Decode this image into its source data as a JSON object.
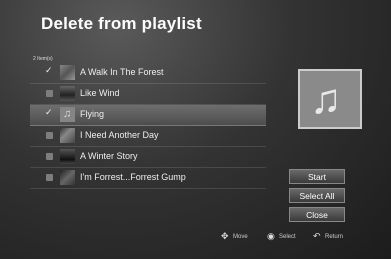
{
  "header": {
    "title": "Delete from playlist"
  },
  "list": {
    "count": "2 Item(s)",
    "items": [
      {
        "label": "A Walk In The Forest",
        "checked": true,
        "selected": false
      },
      {
        "label": "Like Wind",
        "checked": false,
        "selected": false
      },
      {
        "label": "Flying",
        "checked": true,
        "selected": true
      },
      {
        "label": "I Need Another Day",
        "checked": false,
        "selected": false
      },
      {
        "label": "A Winter Story",
        "checked": false,
        "selected": false
      },
      {
        "label": "I'm Forrest...Forrest Gump",
        "checked": false,
        "selected": false
      }
    ]
  },
  "art": {
    "icon": "music-note-icon"
  },
  "buttons": {
    "start": "Start",
    "select_all": "Select All",
    "close": "Close"
  },
  "hints": {
    "move": "Move",
    "select": "Select",
    "return": "Return"
  }
}
